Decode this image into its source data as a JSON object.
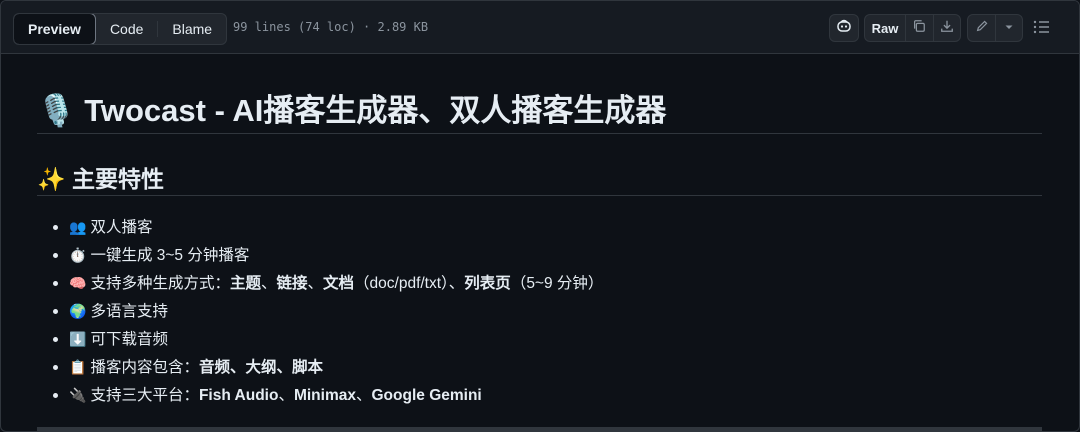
{
  "toolbar": {
    "tabs": [
      {
        "label": "Preview",
        "active": true
      },
      {
        "label": "Code",
        "active": false
      },
      {
        "label": "Blame",
        "active": false
      }
    ],
    "meta": "99 lines (74 loc) · 2.89 KB",
    "raw_label": "Raw",
    "icons": [
      "copilot-icon",
      "copy-icon",
      "download-icon",
      "pencil-icon",
      "chevron-down-icon",
      "list-icon"
    ]
  },
  "readme": {
    "title_emoji": "🎙️",
    "title": "Twocast - AI播客生成器、双人播客生成器",
    "section_emoji": "✨",
    "section": "主要特性",
    "features": [
      {
        "emoji": "👥",
        "text": "双人播客",
        "rich": null
      },
      {
        "emoji": "⏱️",
        "text": "一键生成 3~5 分钟播客",
        "rich": null
      },
      {
        "emoji": "🧠",
        "text": "支持多种生成方式：",
        "rich": [
          {
            "t": "主题",
            "b": true
          },
          {
            "t": "、",
            "b": false
          },
          {
            "t": "链接",
            "b": true
          },
          {
            "t": "、",
            "b": false
          },
          {
            "t": "文档",
            "b": true
          },
          {
            "t": "（doc/pdf/txt）、",
            "b": false
          },
          {
            "t": "列表页",
            "b": true
          },
          {
            "t": "（5~9 分钟）",
            "b": false
          }
        ]
      },
      {
        "emoji": "🌍",
        "text": "多语言支持",
        "rich": null
      },
      {
        "emoji": "⬇️",
        "text": "可下载音频",
        "rich": null
      },
      {
        "emoji": "📋",
        "text": "播客内容包含：",
        "rich": [
          {
            "t": "音频",
            "b": true
          },
          {
            "t": "、",
            "b": true
          },
          {
            "t": "大纲",
            "b": true
          },
          {
            "t": "、",
            "b": true
          },
          {
            "t": "脚本",
            "b": true
          }
        ]
      },
      {
        "emoji": "🔌",
        "text": "支持三大平台：",
        "rich": [
          {
            "t": "Fish Audio",
            "b": true
          },
          {
            "t": "、",
            "b": false
          },
          {
            "t": "Minimax",
            "b": true
          },
          {
            "t": "、",
            "b": false
          },
          {
            "t": "Google Gemini",
            "b": true
          }
        ]
      }
    ]
  }
}
